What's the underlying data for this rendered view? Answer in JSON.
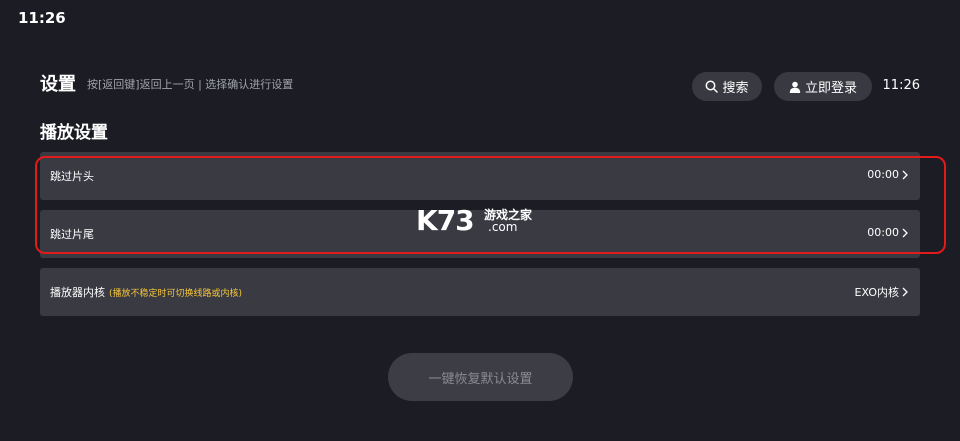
{
  "status_bar": {
    "time": "11:26"
  },
  "header": {
    "title": "设置",
    "hint": "按[返回键]返回上一页 | 选择确认进行设置",
    "search_label": "搜索",
    "login_label": "立即登录",
    "clock": "11:26"
  },
  "section": {
    "title": "播放设置"
  },
  "rows": [
    {
      "label": "跳过片头",
      "value": "00:00"
    },
    {
      "label": "跳过片尾",
      "value": "00:00"
    },
    {
      "label": "播放器内核",
      "note": "(播放不稳定时可切换线路或内核)",
      "value": "EXO内核"
    }
  ],
  "reset_button": {
    "label": "一键恢复默认设置"
  },
  "watermark": {
    "logo": "K73",
    "cn": "游戏之家",
    "com": ".com"
  },
  "colors": {
    "background": "#1c1d24",
    "row_background": "#393a42",
    "note_color": "#f5c63c",
    "highlight_border": "#e11a1a"
  }
}
